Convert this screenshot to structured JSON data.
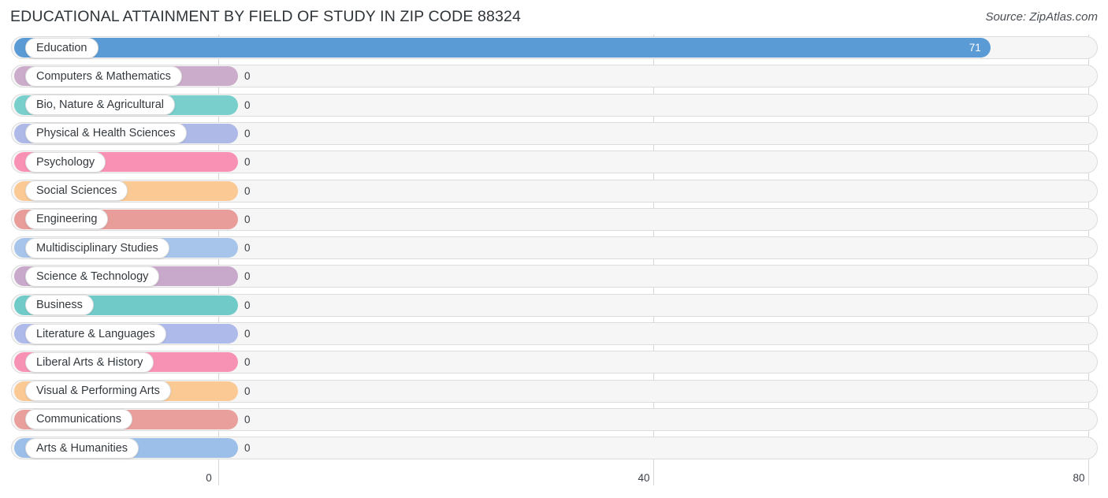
{
  "header": {
    "title": "EDUCATIONAL ATTAINMENT BY FIELD OF STUDY IN ZIP CODE 88324",
    "source": "Source: ZipAtlas.com"
  },
  "chart_data": {
    "type": "bar",
    "orientation": "horizontal",
    "title": "EDUCATIONAL ATTAINMENT BY FIELD OF STUDY IN ZIP CODE 88324",
    "xlabel": "",
    "ylabel": "",
    "xlim": [
      0,
      80
    ],
    "grid": true,
    "legend": "none",
    "ticks": [
      "0",
      "40",
      "80"
    ],
    "tick_values": [
      0,
      40,
      80
    ],
    "categories": [
      "Education",
      "Computers & Mathematics",
      "Bio, Nature & Agricultural",
      "Physical & Health Sciences",
      "Psychology",
      "Social Sciences",
      "Engineering",
      "Multidisciplinary Studies",
      "Science & Technology",
      "Business",
      "Literature & Languages",
      "Liberal Arts & History",
      "Visual & Performing Arts",
      "Communications",
      "Arts & Humanities"
    ],
    "values": [
      71,
      0,
      0,
      0,
      0,
      0,
      0,
      0,
      0,
      0,
      0,
      0,
      0,
      0,
      0
    ],
    "value_labels": [
      "71",
      "0",
      "0",
      "0",
      "0",
      "0",
      "0",
      "0",
      "0",
      "0",
      "0",
      "0",
      "0",
      "0",
      "0"
    ],
    "colors": [
      "#5b9bd5",
      "#cbacca",
      "#79cfcc",
      "#aeb9e8",
      "#f891b4",
      "#fbc994",
      "#e99d9b",
      "#a7c4ea",
      "#c8a8cb",
      "#70cbc8",
      "#aebae9",
      "#f892b5",
      "#fbc994",
      "#e9a09d",
      "#9bbfe8"
    ]
  }
}
